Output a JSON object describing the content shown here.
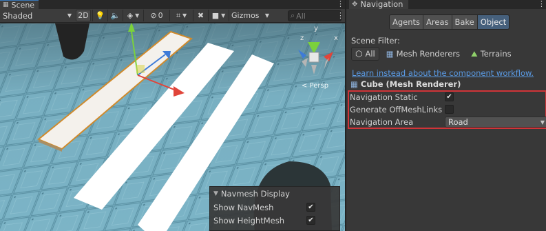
{
  "scene": {
    "tab_label": "Scene",
    "toolbar": {
      "shading": "Shaded",
      "mode_2d": "2D",
      "hidden_count": "0",
      "gizmos": "Gizmos",
      "search_placeholder": "All"
    },
    "gizmo_label": "< Persp",
    "gizmo_axes": {
      "y": "y",
      "x": "x",
      "z": "z"
    },
    "navmesh_display": {
      "title": "Navmesh Display",
      "items": [
        {
          "label": "Show NavMesh",
          "checked": true,
          "mark": "✔"
        },
        {
          "label": "Show HeightMesh",
          "checked": true,
          "mark": "✔"
        }
      ]
    }
  },
  "navigation": {
    "tab_label": "Navigation",
    "tabs": [
      {
        "label": "Agents",
        "active": false
      },
      {
        "label": "Areas",
        "active": false
      },
      {
        "label": "Bake",
        "active": false
      },
      {
        "label": "Object",
        "active": true
      }
    ],
    "scene_filter_label": "Scene Filter:",
    "filters": [
      {
        "label": "All",
        "icon": "cube-outline-icon"
      },
      {
        "label": "Mesh Renderers",
        "icon": "mesh-grid-icon"
      },
      {
        "label": "Terrains",
        "icon": "terrain-icon"
      }
    ],
    "workflow_link": "Learn instead about the component workflow.",
    "object_title": "Cube (Mesh Renderer)",
    "properties": {
      "navigation_static": {
        "label": "Navigation Static",
        "checked": true,
        "mark": "✔"
      },
      "generate_offmesh": {
        "label": "Generate OffMeshLinks",
        "checked": false,
        "mark": ""
      },
      "navigation_area": {
        "label": "Navigation Area",
        "value": "Road"
      }
    }
  },
  "colors": {
    "highlight": "#d13438",
    "link": "#5a9be5",
    "active_tab": "#46607c"
  }
}
